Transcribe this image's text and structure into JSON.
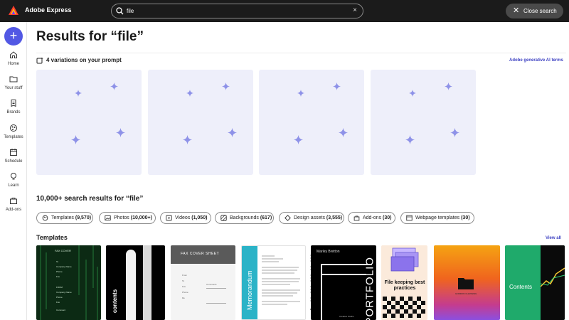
{
  "app": {
    "title": "Adobe Express"
  },
  "search": {
    "value": "file",
    "clear_symbol": "×"
  },
  "close_search": {
    "label": "Close search"
  },
  "sidebar": {
    "create_symbol": "+",
    "items": [
      {
        "label": "Home",
        "icon": "home-icon"
      },
      {
        "label": "Your stuff",
        "icon": "folder-icon"
      },
      {
        "label": "Brands",
        "icon": "brand-icon"
      },
      {
        "label": "Templates",
        "icon": "templates-icon"
      },
      {
        "label": "Schedule",
        "icon": "calendar-icon"
      },
      {
        "label": "Learn",
        "icon": "lightbulb-icon"
      },
      {
        "label": "Add-ons",
        "icon": "addons-icon"
      }
    ]
  },
  "main": {
    "heading": "Results for “file”",
    "variations_label": "4 variations on your prompt",
    "ai_terms": "Adobe generative AI terms",
    "results_heading": "10,000+ search results for “file”",
    "chips": [
      {
        "label": "Templates",
        "count": "(9,570)",
        "icon": "templates-icon"
      },
      {
        "label": "Photos",
        "count": "(10,000+)",
        "icon": "photo-icon"
      },
      {
        "label": "Videos",
        "count": "(1,050)",
        "icon": "video-icon"
      },
      {
        "label": "Backgrounds",
        "count": "(617)",
        "icon": "background-icon"
      },
      {
        "label": "Design assets",
        "count": "(3,555)",
        "icon": "design-assets-icon"
      },
      {
        "label": "Add-ons",
        "count": "(30)",
        "icon": "addons-icon"
      },
      {
        "label": "Webpage templates",
        "count": "(30)",
        "icon": "webpage-icon"
      }
    ],
    "templates_heading": "Templates",
    "view_all": "View all",
    "templates": {
      "fax_green": {
        "title": "FAX COVER",
        "lines": [
          "To",
          "Company Name",
          "Phone",
          "Fax",
          "FROM",
          "Company Name",
          "Phone",
          "Fax",
          "Comment"
        ]
      },
      "contents_black": {
        "title": "contents"
      },
      "fax_grey": {
        "title": "FAX COVER SHEET",
        "fields": [
          "From",
          "To",
          "Fax",
          "Phone",
          "Re",
          "Comments"
        ]
      },
      "memorandum": {
        "title": "Memorandum"
      },
      "memo_text": {
        "date": "Date: 8"
      },
      "portfolio": {
        "name": "Marley Bretton",
        "title": "PORTFOLIO",
        "subtitle": "Creative Studio"
      },
      "file_keeping": {
        "title": "File keeping best practices"
      },
      "folder_gradient": {
        "caption": "GORDON CHANNING"
      },
      "contents_green": {
        "title": "Contents"
      }
    }
  },
  "colors": {
    "topbar": "#1b1b1b",
    "accent": "#5258e4",
    "link": "#3d41c2",
    "variation_card": "#eeeffa",
    "sparkle": "#8e92e8"
  }
}
